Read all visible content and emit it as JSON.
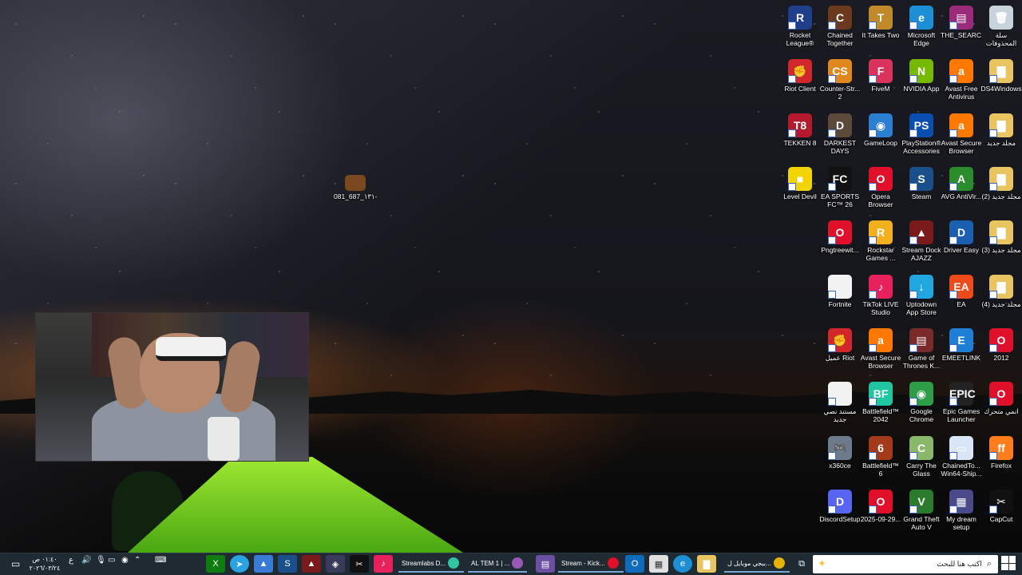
{
  "desktop": {
    "loose_file": {
      "label": "رمضان-١٣١_687_081...",
      "icon": "image-thumbnail-icon"
    },
    "icons": [
      {
        "label": "Rocket League®",
        "color": "#1f3f8a",
        "glyph": "R"
      },
      {
        "label": "Chained Together",
        "color": "#6b3a1e",
        "glyph": "C"
      },
      {
        "label": "It Takes Two",
        "color": "#c08a2a",
        "glyph": "T"
      },
      {
        "label": "Microsoft Edge",
        "color": "#1d8fd6",
        "glyph": "e"
      },
      {
        "label": "THE_SEARC...",
        "color": "#9b2b7a",
        "glyph": "▤"
      },
      {
        "label": "سلة المحذوفات",
        "color": "#c9d3dc",
        "glyph": "🗑"
      },
      {
        "label": "Riot Client",
        "color": "#d0262c",
        "glyph": "✊"
      },
      {
        "label": "Counter-Str... 2",
        "color": "#e0871d",
        "glyph": "CS"
      },
      {
        "label": "FiveM",
        "color": "#d8325d",
        "glyph": "F"
      },
      {
        "label": "NVIDIA App",
        "color": "#76b900",
        "glyph": "N"
      },
      {
        "label": "Avast Free Antivirus",
        "color": "#ff7800",
        "glyph": "a"
      },
      {
        "label": "DS4Windows",
        "color": "#e8c560",
        "glyph": "▇"
      },
      {
        "label": "TEKKEN 8",
        "color": "#b5192d",
        "glyph": "T8"
      },
      {
        "label": "DARKEST DAYS",
        "color": "#5b4a3a",
        "glyph": "D"
      },
      {
        "label": "GameLoop",
        "color": "#2a7fd1",
        "glyph": "◉"
      },
      {
        "label": "PlayStation® Accessories",
        "color": "#0a4fb0",
        "glyph": "PS"
      },
      {
        "label": "Avast Secure Browser",
        "color": "#ff7800",
        "glyph": "a"
      },
      {
        "label": "مجلد جديد",
        "color": "#e8c560",
        "glyph": "▇"
      },
      {
        "label": "Level Devil",
        "color": "#f2d500",
        "glyph": "■"
      },
      {
        "label": "EA SPORTS FC™ 26",
        "color": "#111111",
        "glyph": "FC"
      },
      {
        "label": "Opera Browser",
        "color": "#e0102a",
        "glyph": "O"
      },
      {
        "label": "Steam",
        "color": "#1b4f8a",
        "glyph": "S"
      },
      {
        "label": "AVG AntiVir...",
        "color": "#2a8c2a",
        "glyph": "A"
      },
      {
        "label": "مجلد جديد (2)",
        "color": "#e8c560",
        "glyph": "▇"
      },
      {
        "label": "Pngtreewit...",
        "color": "#e0102a",
        "glyph": "O"
      },
      {
        "label": "Rockstar Games ...",
        "color": "#f2b01e",
        "glyph": "R"
      },
      {
        "label": "Stream Dock AJAZZ",
        "color": "#7a1a1a",
        "glyph": "▲"
      },
      {
        "label": "Driver Easy",
        "color": "#1a5fb0",
        "glyph": "D"
      },
      {
        "label": "مجلد جديد (3)",
        "color": "#e8c560",
        "glyph": "▇"
      },
      {
        "label": "Fortnite",
        "color": "#f2f2f2",
        "glyph": " "
      },
      {
        "label": "TikTok LIVE Studio",
        "color": "#e6215c",
        "glyph": "♪"
      },
      {
        "label": "Uptodown App Store",
        "color": "#20a7e0",
        "glyph": "↓"
      },
      {
        "label": "EA",
        "color": "#ef4a1a",
        "glyph": "EA"
      },
      {
        "label": "مجلد جديد (4)",
        "color": "#e8c560",
        "glyph": "▇"
      },
      {
        "label": "عميل Riot",
        "color": "#d0262c",
        "glyph": "✊"
      },
      {
        "label": "Avast Secure Browser",
        "color": "#ff7800",
        "glyph": "a"
      },
      {
        "label": "Game of Thrones K...",
        "color": "#7a2a2a",
        "glyph": "▤"
      },
      {
        "label": "EMEETLINK",
        "color": "#1f7fd6",
        "glyph": "E"
      },
      {
        "label": "2012",
        "color": "#e0102a",
        "glyph": "O"
      },
      {
        "label": "مستند نصي جديد",
        "color": "#f2f2f2",
        "glyph": " "
      },
      {
        "label": "Battlefield™ 2042",
        "color": "#20c6a0",
        "glyph": "BF"
      },
      {
        "label": "Google Chrome",
        "color": "#2e9d48",
        "glyph": "◉"
      },
      {
        "label": "Epic Games Launcher",
        "color": "#222222",
        "glyph": "EPIC"
      },
      {
        "label": "انمي متحرك",
        "color": "#e0102a",
        "glyph": "O"
      },
      {
        "label": "x360ce",
        "color": "#6d7a8a",
        "glyph": "🎮"
      },
      {
        "label": "Battlefield™ 6",
        "color": "#a33a1a",
        "glyph": "6"
      },
      {
        "label": "Carry The Glass",
        "color": "#8ab86a",
        "glyph": "C"
      },
      {
        "label": "ChainedTo... Win64-Ship...",
        "color": "#d8e6f5",
        "glyph": "▭"
      },
      {
        "label": "Firefox",
        "color": "#ff7d1a",
        "glyph": "ff"
      },
      {
        "label": "DiscordSetup",
        "color": "#5865f2",
        "glyph": "D"
      },
      {
        "label": "2025-09-29...",
        "color": "#e0102a",
        "glyph": "O"
      },
      {
        "label": "Grand Theft Auto V",
        "color": "#2c7a2c",
        "glyph": "V"
      },
      {
        "label": "My dream setup",
        "color": "#4a4a8a",
        "glyph": "▦"
      },
      {
        "label": "CapCut",
        "color": "#111111",
        "glyph": "✂"
      }
    ]
  },
  "taskbar": {
    "search_placeholder": "اكتب هنا للبحث",
    "clock_time": "٠١:٤٠ ص",
    "clock_date": "٢٠٢٦/٠٣/٢٤",
    "tray_lang": "ع",
    "apps": [
      {
        "label": "ببجي موبايل ل...",
        "color": "#e6b400"
      },
      {
        "label": "Stream - Kick...",
        "color": "#e0102a"
      },
      {
        "label": "AL TEM 1 | ...",
        "color": "#9b59b6"
      },
      {
        "label": "Streamlabs D...",
        "color": "#31c3a2"
      }
    ]
  }
}
